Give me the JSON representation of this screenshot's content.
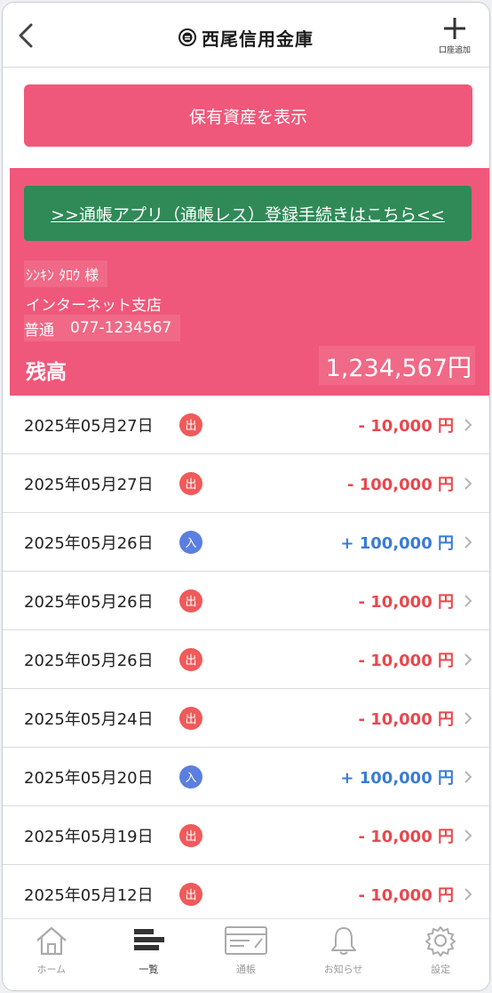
{
  "header": {
    "bank_name": "西尾信用金庫",
    "add_account_label": "口座追加"
  },
  "assets_button": "保有資産を表示",
  "account": {
    "passbook_link": ">>通帳アプリ（通帳レス）登録手続きはこちら<<",
    "holder": "ｼﾝｷﾝ ﾀﾛｳ 様",
    "branch": "インターネット支店",
    "type": "普通",
    "number": "077-1234567",
    "balance_label": "残高",
    "balance": "1,234,567円"
  },
  "transactions": [
    {
      "date": "2025年05月27日",
      "kind": "出",
      "amount": "- 10,000 円"
    },
    {
      "date": "2025年05月27日",
      "kind": "出",
      "amount": "- 100,000 円"
    },
    {
      "date": "2025年05月26日",
      "kind": "入",
      "amount": "+ 100,000 円"
    },
    {
      "date": "2025年05月26日",
      "kind": "出",
      "amount": "- 10,000 円"
    },
    {
      "date": "2025年05月26日",
      "kind": "出",
      "amount": "- 10,000 円"
    },
    {
      "date": "2025年05月24日",
      "kind": "出",
      "amount": "- 10,000 円"
    },
    {
      "date": "2025年05月20日",
      "kind": "入",
      "amount": "+ 100,000 円"
    },
    {
      "date": "2025年05月19日",
      "kind": "出",
      "amount": "- 10,000 円"
    },
    {
      "date": "2025年05月12日",
      "kind": "出",
      "amount": "- 10,000 円"
    }
  ],
  "tabs": [
    {
      "label": "ホーム",
      "icon": "home-icon"
    },
    {
      "label": "一覧",
      "icon": "list-icon"
    },
    {
      "label": "通帳",
      "icon": "passbook-icon"
    },
    {
      "label": "お知らせ",
      "icon": "bell-icon"
    },
    {
      "label": "設定",
      "icon": "gear-icon"
    }
  ],
  "colors": {
    "brand_pink": "#ef587a",
    "link_green": "#2f8a57",
    "withdraw_red": "#e8484d",
    "deposit_blue": "#3a7bd5",
    "withdraw_badge": "#ef5a5a",
    "deposit_badge": "#5b7fe0"
  }
}
